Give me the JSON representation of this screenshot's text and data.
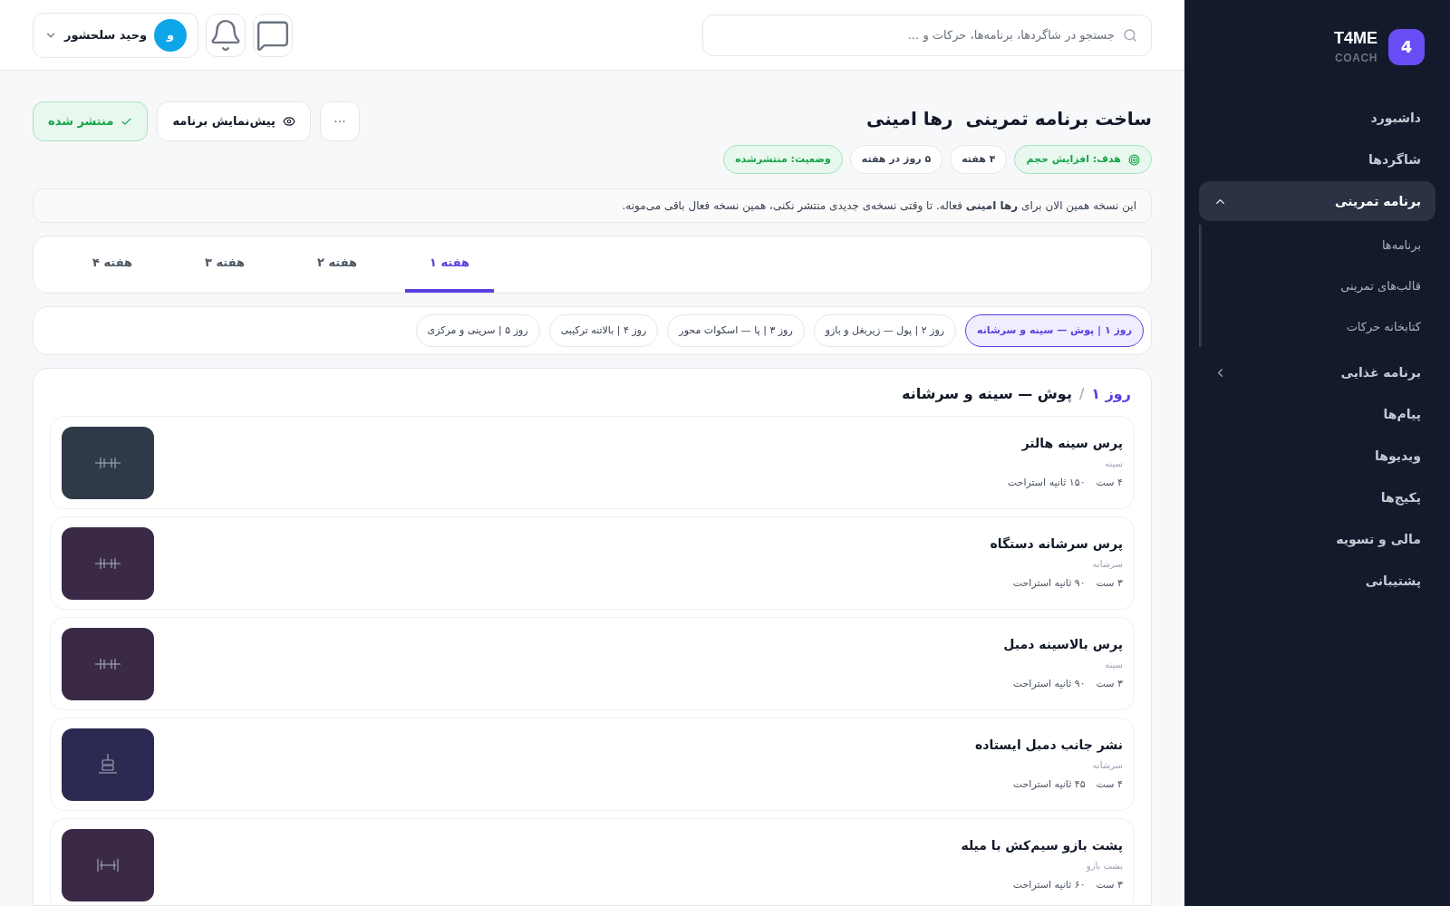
{
  "brand": {
    "logo": "4",
    "name": "T4ME",
    "tagline": "COACH"
  },
  "sidebar": {
    "items": [
      {
        "label": "داشبورد",
        "selected": false
      },
      {
        "label": "شاگردها",
        "selected": false
      },
      {
        "label": "برنامه تمرینی",
        "selected": true,
        "expanded": true,
        "children": [
          {
            "label": "برنامه‌ها"
          },
          {
            "label": "قالب‌های تمرینی"
          },
          {
            "label": "کتابخانه حرکات"
          }
        ]
      },
      {
        "label": "برنامه غذایی",
        "selected": false,
        "expanded": false
      },
      {
        "label": "پیام‌ها",
        "selected": false
      },
      {
        "label": "ویدیوها",
        "selected": false
      },
      {
        "label": "پکیج‌ها",
        "selected": false
      },
      {
        "label": "مالی و تسویه",
        "selected": false
      },
      {
        "label": "پشتیبانی",
        "selected": false
      }
    ]
  },
  "header": {
    "search": {
      "placeholder": "جستجو در شاگردها، برنامه‌ها، حرکات و ..."
    },
    "user": {
      "initial": "و",
      "name": "وحید سلحشور"
    }
  },
  "page": {
    "title": "ساخت برنامه تمرینی  رها امینی",
    "badges": [
      {
        "kind": "goal",
        "label": "هدف: افزایش حجم"
      },
      {
        "kind": "plain",
        "label": "۴ هفته"
      },
      {
        "kind": "plain",
        "label": "۵ روز در هفته"
      },
      {
        "kind": "status",
        "label": "وضعیت: منتشرشده"
      }
    ],
    "actions": {
      "more": "···",
      "preview": "پیش‌نمایش برنامه",
      "published": "منتشر شده"
    },
    "notice": "این نسخه همین الان برای **رها امینی** فعاله. تا وقتی نسخه‌ی جدیدی منتشر نکنی، همین نسخه فعال باقی می‌مونه."
  },
  "week_tabs": [
    {
      "label": "هفته ۱",
      "selected": true
    },
    {
      "label": "هفته ۲",
      "selected": false
    },
    {
      "label": "هفته ۳",
      "selected": false
    },
    {
      "label": "هفته ۴",
      "selected": false
    }
  ],
  "day_chips": [
    {
      "label": "روز ۱ | پوش — سینه و سرشانه",
      "selected": true
    },
    {
      "label": "روز ۲ | پول — زیربغل و بازو",
      "selected": false
    },
    {
      "label": "روز ۳ | پا — اسکوات محور",
      "selected": false
    },
    {
      "label": "روز ۴ | بالاتنه ترکیبی",
      "selected": false
    },
    {
      "label": "روز ۵ | سرینی و مرکزی",
      "selected": false
    }
  ],
  "day": {
    "day_label": "روز ۱",
    "separator": "/",
    "title": "پوش — سینه و سرشانه",
    "exercises": [
      {
        "name": "پرس سینه هالتر",
        "muscle": "سینه",
        "sets": "۴ ست",
        "rest": "۱۵۰ ثانیه استراحت",
        "kind": "barbell",
        "color": "#2f3a48"
      },
      {
        "name": "پرس سرشانه دستگاه",
        "muscle": "سرشانه",
        "sets": "۳ ست",
        "rest": "۹۰ ثانیه استراحت",
        "kind": "barbell",
        "color": "#3a2a48"
      },
      {
        "name": "پرس بالاسینه دمبل",
        "muscle": "سینه",
        "sets": "۳ ست",
        "rest": "۹۰ ثانیه استراحت",
        "kind": "barbell",
        "color": "#3a2a48"
      },
      {
        "name": "نشر جانب دمبل ایستاده",
        "muscle": "سرشانه",
        "sets": "۴ ست",
        "rest": "۴۵ ثانیه استراحت",
        "kind": "weights",
        "color": "#2c2a52"
      },
      {
        "name": "پشت بازو سیم‌کش با میله",
        "muscle": "پشت بازو",
        "sets": "۳ ست",
        "rest": "۶۰ ثانیه استراحت",
        "kind": "dumbbell",
        "color": "#3a2a48"
      }
    ]
  }
}
